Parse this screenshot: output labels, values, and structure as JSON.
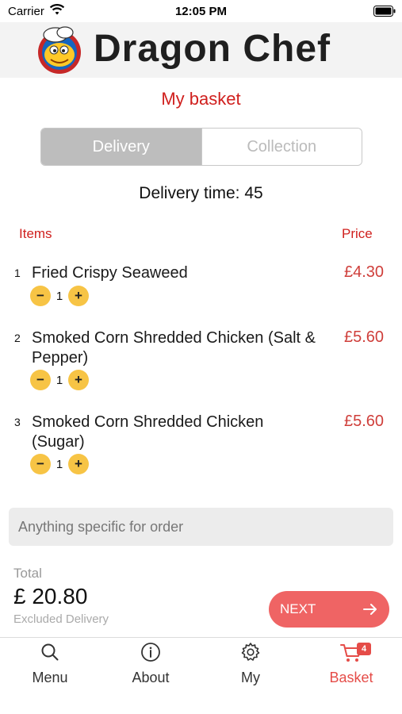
{
  "status_bar": {
    "carrier": "Carrier",
    "time": "12:05 PM"
  },
  "header": {
    "brand": "Dragon Chef"
  },
  "page": {
    "title": "My basket"
  },
  "fulfilment": {
    "options": [
      "Delivery",
      "Collection"
    ],
    "selected": "Delivery"
  },
  "delivery_time_text": "Delivery time: 45",
  "table": {
    "items_header": "Items",
    "price_header": "Price"
  },
  "items": [
    {
      "index": "1",
      "name": "Fried Crispy Seaweed",
      "price": "£4.30",
      "quantity": "1"
    },
    {
      "index": "2",
      "name": "Smoked Corn Shredded Chicken (Salt & Pepper)",
      "price": "£5.60",
      "quantity": "1"
    },
    {
      "index": "3",
      "name": "Smoked Corn Shredded Chicken (Sugar)",
      "price": "£5.60",
      "quantity": "1"
    }
  ],
  "qty_controls": {
    "minus": "−",
    "plus": "+"
  },
  "note": {
    "placeholder": "Anything specific for order"
  },
  "summary": {
    "total_label": "Total",
    "total_value": "£ 20.80",
    "note": "Excluded Delivery"
  },
  "next_button": {
    "label": "NEXT"
  },
  "tabs": [
    {
      "label": "Menu",
      "icon": "search-icon"
    },
    {
      "label": "About",
      "icon": "info-icon"
    },
    {
      "label": "My",
      "icon": "gear-icon"
    },
    {
      "label": "Basket",
      "icon": "cart-icon",
      "badge": "4",
      "active": true
    }
  ],
  "colors": {
    "accent": "#d0201e",
    "price": "#cf3e3a",
    "qty_button": "#f7c445",
    "next_button": "#ef6464",
    "active_tab": "#e54c48",
    "segment_active": "#bdbdbd"
  }
}
